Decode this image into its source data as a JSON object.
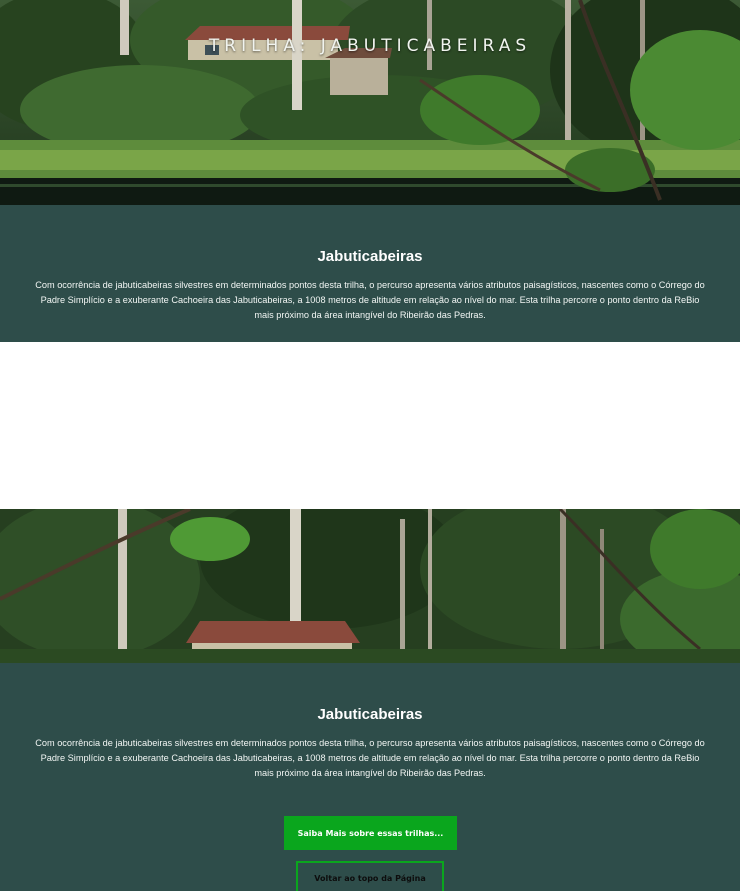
{
  "hero": {
    "title": "TRILHA: JABUTICABEIRAS"
  },
  "sections": [
    {
      "heading": "Jabuticabeiras",
      "text": "Com ocorrência de jabuticabeiras silvestres em determinados pontos desta trilha, o percurso apresenta vários atributos paisagísticos, nascentes como o Córrego do Padre Simplício e a exuberante Cachoeira das Jabuticabeiras, a 1008 metros de altitude em relação ao nível do mar. Esta trilha percorre o ponto dentro da ReBio mais próximo da área intangível do Ribeirão das Pedras."
    },
    {
      "heading": "Jabuticabeiras",
      "text": "Com ocorrência de jabuticabeiras silvestres em determinados pontos desta trilha, o percurso apresenta vários atributos paisagísticos, nascentes como o Córrego do Padre Simplício e a exuberante Cachoeira das Jabuticabeiras, a 1008 metros de altitude em relação ao nível do mar. Esta trilha percorre o ponto dentro da ReBio mais próximo da área intangível do Ribeirão das Pedras."
    }
  ],
  "buttons": {
    "more": "Saiba Mais sobre essas trilhas...",
    "top": "Voltar ao topo da Página"
  },
  "colors": {
    "panel": "#2e4d4a",
    "button_green": "#0aa61d"
  }
}
